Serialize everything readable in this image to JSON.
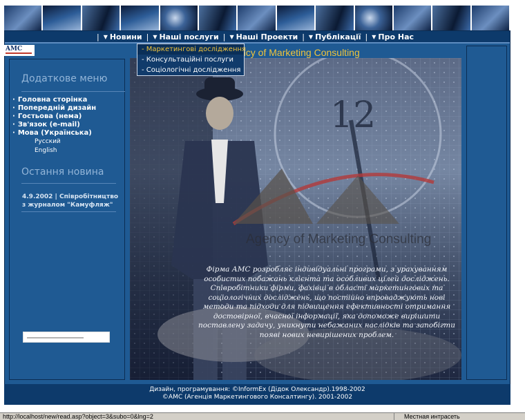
{
  "nav": {
    "items": [
      {
        "label": "Новини"
      },
      {
        "label": "Наші послуги"
      },
      {
        "label": "Наші Проекти"
      },
      {
        "label": "Публікації"
      },
      {
        "label": "Про Нас"
      }
    ]
  },
  "dropdown": {
    "items": [
      {
        "label": "Маркетингові дослідження"
      },
      {
        "label": "Консультаційні послуги"
      },
      {
        "label": "Соціологічні дослідження"
      }
    ]
  },
  "logo": {
    "text": "AMC"
  },
  "sidebar": {
    "title": "Додаткове меню",
    "items": [
      {
        "label": "Головна сторінка"
      },
      {
        "label": "Попередній дизайн"
      },
      {
        "label": "Гостьова (нема)"
      },
      {
        "label": "Зв'язок (e-mail)"
      },
      {
        "label": "Мова (Українська)"
      }
    ],
    "languages": [
      {
        "label": "Русский"
      },
      {
        "label": "English"
      }
    ],
    "news_title": "Остання новина",
    "news_item": "4.9.2002 | Співробітництво з журналом \"Камуфляж\""
  },
  "main": {
    "headline": "ncy of Marketing Consulting",
    "logo_text": "Agency of Marketing Consulting",
    "clock_number": "12",
    "body": "Фірма АМС розробляє індивідуальні програми, з урахуванням особистих побажань клієнта та особливих цілей досліджень. Співробітники фірми, фахівці в області маркетингових та соціологічних досліджень, що постійно впроваджують нові методи та підходи для підвищення ефективності отримання достовірної, вчасної інформації, яка допоможе вирішити поставлену задачу, уникнути небажаних наслідків та запобігти появі нових невирішених проблем."
  },
  "footer": {
    "line1": "Дизайн, програмування: ©InformEx (Дідок Олександр).1998-2002",
    "line2": "©АМС (Агенція Маркетингового Консалтингу). 2001-2002"
  },
  "status": {
    "url": "http://localhost/new/read.asp?object=3&subo=0&lng=2",
    "zone": "Местная интрасеть"
  },
  "colors": {
    "accent": "#f1c33b",
    "frame": "#1f5a93",
    "navbar": "#0d3a6b"
  }
}
